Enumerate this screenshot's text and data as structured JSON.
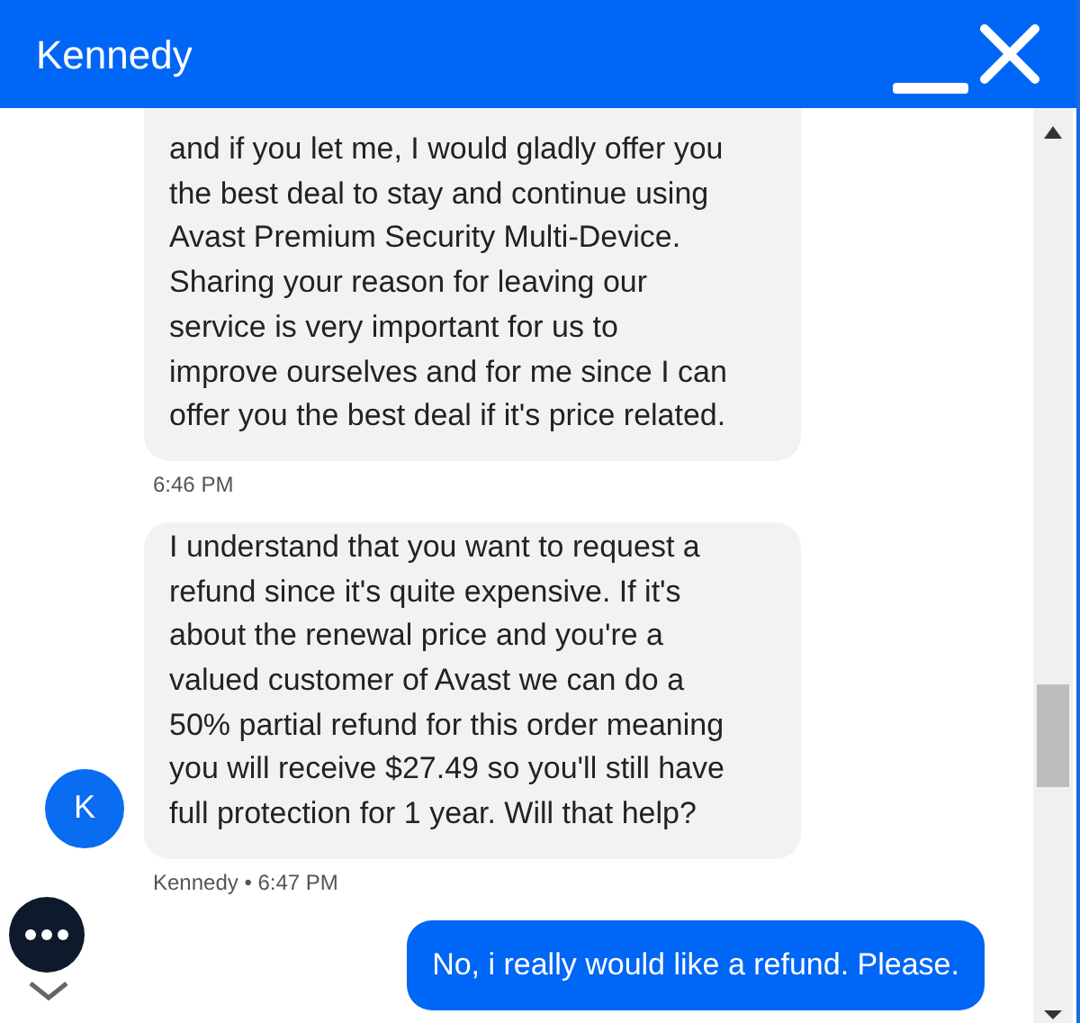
{
  "header": {
    "title": "Kennedy"
  },
  "messages": [
    {
      "kind": "agent",
      "lines": [
        "and if you let me, I would gladly offer you",
        "the best deal to stay and continue using",
        "Avast Premium Security Multi-Device.",
        "Sharing your reason for leaving our",
        "service is very important for us to",
        "improve ourselves and for me since I can",
        "offer you the best deal if it's price related."
      ],
      "meta": "6:46 PM"
    },
    {
      "kind": "agent",
      "lines": [
        "I understand that you want to request a",
        "refund since it's quite expensive. If it's",
        "about the renewal price and you're a",
        "valued customer of Avast we can do a",
        "50% partial refund for this order meaning",
        "you will receive $27.49 so you'll still have",
        "full protection for 1 year. Will that help?"
      ],
      "meta": "Kennedy • 6:47 PM",
      "avatar": "K"
    },
    {
      "kind": "user",
      "lines": [
        "No, i really would like a refund. Please."
      ]
    }
  ]
}
